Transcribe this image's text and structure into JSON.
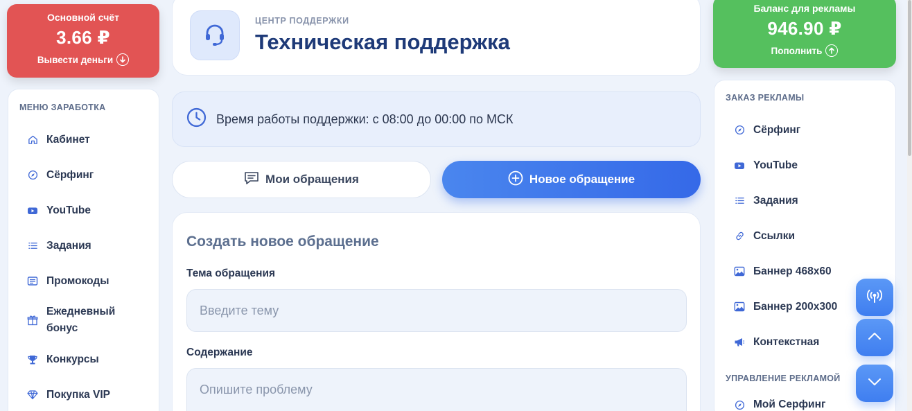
{
  "balances": {
    "main": {
      "title": "Основной счёт",
      "amount": "3.66 ₽",
      "action": "Вывести деньги",
      "color": "#e25454"
    },
    "ads": {
      "title": "Баланс для рекламы",
      "amount": "946.90 ₽",
      "action": "Пополнить",
      "color": "#55c05e"
    }
  },
  "left_menu": {
    "heading": "МЕНЮ ЗАРАБОТКА",
    "items": [
      {
        "label": "Кабинет",
        "icon": "home-icon"
      },
      {
        "label": "Сёрфинг",
        "icon": "compass-icon"
      },
      {
        "label": "YouTube",
        "icon": "youtube-icon"
      },
      {
        "label": "Задания",
        "icon": "list-icon"
      },
      {
        "label": "Промокоды",
        "icon": "card-icon"
      },
      {
        "label": "Ежедневный бонус",
        "icon": "gift-icon"
      },
      {
        "label": "Конкурсы",
        "icon": "trophy-icon"
      },
      {
        "label": "Покупка VIP",
        "icon": "diamond-icon"
      }
    ]
  },
  "header": {
    "eyebrow": "ЦЕНТР ПОДДЕРЖКИ",
    "title": "Техническая поддержка",
    "icon": "headset-icon"
  },
  "hours": {
    "text": "Время работы поддержки: с 08:00 до 00:00 по МСК",
    "icon": "clock-icon"
  },
  "tabs": {
    "my": "Мои обращения",
    "new": "Новое обращение"
  },
  "form": {
    "title": "Создать новое обращение",
    "subject_label": "Тема обращения",
    "subject_placeholder": "Введите тему",
    "content_label": "Содержание",
    "content_placeholder": "Опишите проблему"
  },
  "right_menu": {
    "heading": "ЗАКАЗ РЕКЛАМЫ",
    "items": [
      {
        "label": "Сёрфинг",
        "icon": "compass-icon"
      },
      {
        "label": "YouTube",
        "icon": "youtube-icon"
      },
      {
        "label": "Задания",
        "icon": "list-icon"
      },
      {
        "label": "Ссылки",
        "icon": "link-icon"
      },
      {
        "label": "Баннер 468x60",
        "icon": "image-icon"
      },
      {
        "label": "Баннер 200x300",
        "icon": "image-icon"
      },
      {
        "label": "Контекстная",
        "icon": "megaphone-icon"
      }
    ],
    "heading2": "УПРАВЛЕНИЕ РЕКЛАМОЙ",
    "items2": [
      {
        "label": "Мой Серфинг",
        "icon": "compass-icon"
      }
    ]
  },
  "accent": "#3569e8"
}
